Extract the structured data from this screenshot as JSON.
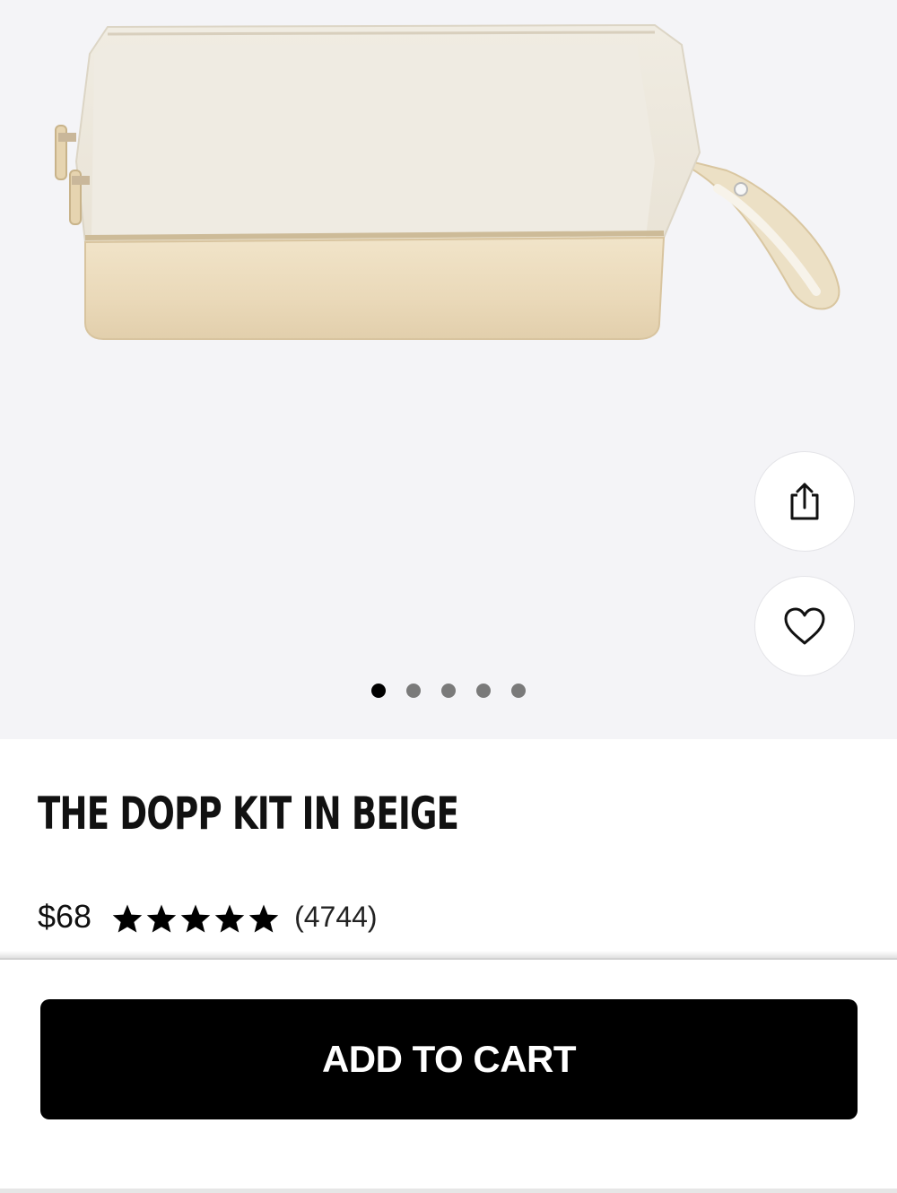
{
  "product": {
    "title": "THE DOPP KIT IN BEIGE",
    "price": "$68",
    "rating": 5,
    "max_rating": 5,
    "review_count": "(4744)",
    "image_name": "beige-dopp-kit-photo"
  },
  "gallery": {
    "dot_count": 5,
    "active_index": 0,
    "share_icon": "share-icon",
    "favorite_icon": "heart-icon"
  },
  "cart": {
    "button_label": "ADD TO CART"
  },
  "colors": {
    "gallery_bg": "#f4f4f7",
    "canvas_light": "#eee9dc",
    "leather_base": "#ebdcbf",
    "button_bg": "#000000",
    "button_text": "#ffffff"
  }
}
